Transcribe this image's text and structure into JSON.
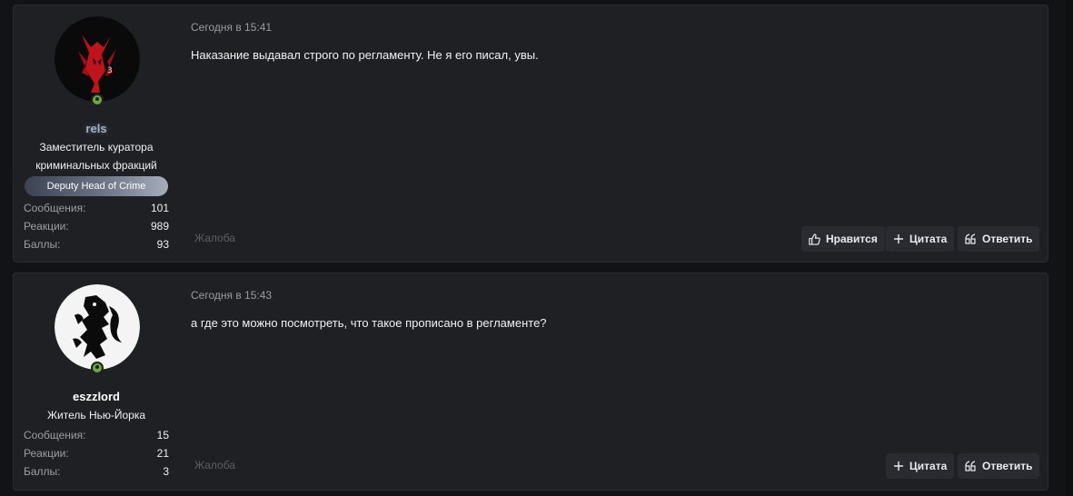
{
  "posts": [
    {
      "username": "rels",
      "user_title_line1": "Заместитель куратора",
      "user_title_line2": "криминальных фракций",
      "banner": "Deputy Head of Crime",
      "stats": [
        {
          "label": "Сообщения:",
          "value": "101"
        },
        {
          "label": "Реакции:",
          "value": "989"
        },
        {
          "label": "Баллы:",
          "value": "93"
        }
      ],
      "date": "Сегодня в 15:41",
      "message": "Наказание выдавал строго по регламенту. Не я его писал, увы.",
      "report": "Жалоба",
      "actions": {
        "like": "Нравится",
        "quote": "Цитата",
        "reply": "Ответить"
      },
      "avatar_icon": "red-demon-avatar",
      "online_color": "#6ea83a"
    },
    {
      "username": "eszzlord",
      "user_title_line1": "Житель Нью-Йорка",
      "stats": [
        {
          "label": "Сообщения:",
          "value": "15"
        },
        {
          "label": "Реакции:",
          "value": "21"
        },
        {
          "label": "Баллы:",
          "value": "3"
        }
      ],
      "date": "Сегодня в 15:43",
      "message": "а где это можно посмотреть, что такое прописано в регламенте?",
      "report": "Жалоба",
      "actions": {
        "quote": "Цитата",
        "reply": "Ответить"
      },
      "avatar_icon": "heraldic-lion-avatar",
      "online_color": "#6ea83a"
    }
  ]
}
